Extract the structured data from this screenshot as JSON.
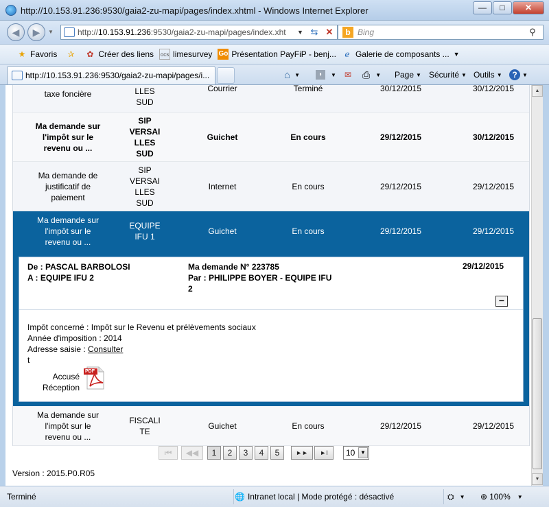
{
  "window": {
    "title": "http://10.153.91.236:9530/gaia2-zu-mapi/pages/index.xhtml - Windows Internet Explorer",
    "minimize": "—",
    "maximize": "□",
    "close": "✕"
  },
  "nav": {
    "url_prefix": "http://",
    "url_host": "10.153.91.236",
    "url_rest": ":9530/gaia2-zu-mapi/pages/index.xht",
    "search_placeholder": "Bing"
  },
  "favorites": {
    "label": "Favoris",
    "items": [
      "Créer des liens",
      "limesurvey",
      "Présentation PayFiP - benj...",
      "Galerie de composants ..."
    ]
  },
  "tab": {
    "label": "http://10.153.91.236:9530/gaia2-zu-mapi/pages/i..."
  },
  "commands": {
    "page": "Page",
    "security": "Sécurité",
    "tools": "Outils"
  },
  "rows": [
    {
      "subject": "taxe foncière",
      "service": [
        "LLES",
        "SUD"
      ],
      "channel": "Courrier",
      "status": "Terminé",
      "date1": "30/12/2015",
      "date2": "30/12/2015"
    },
    {
      "subject": [
        "Ma demande sur",
        "l'impôt sur le",
        "revenu ou ..."
      ],
      "service": [
        "SIP",
        "VERSAI",
        "LLES",
        "SUD"
      ],
      "channel": "Guichet",
      "status": "En cours",
      "date1": "29/12/2015",
      "date2": "30/12/2015"
    },
    {
      "subject": [
        "Ma demande de",
        "justificatif de",
        "paiement"
      ],
      "service": [
        "SIP",
        "VERSAI",
        "LLES",
        "SUD"
      ],
      "channel": "Internet",
      "status": "En cours",
      "date1": "29/12/2015",
      "date2": "29/12/2015"
    },
    {
      "subject": [
        "Ma demande sur",
        "l'impôt sur le",
        "revenu ou ..."
      ],
      "service": [
        "EQUIPE",
        "IFU 1"
      ],
      "channel": "Guichet",
      "status": "En cours",
      "date1": "29/12/2015",
      "date2": "29/12/2015"
    },
    {
      "subject": [
        "Ma demande sur",
        "l'impôt sur le",
        "revenu ou ..."
      ],
      "service": [
        "FISCALI",
        "TE"
      ],
      "channel": "Guichet",
      "status": "En cours",
      "date1": "29/12/2015",
      "date2": "29/12/2015"
    }
  ],
  "detail": {
    "from": "De : PASCAL BARBOLOSI",
    "to": "A : EQUIPE IFU 2",
    "request": "Ma demande N° 223785",
    "by": [
      "Par : PHILIPPE BOYER - EQUIPE IFU",
      "2"
    ],
    "date": "29/12/2015",
    "collapse": "−",
    "tax": "Impôt concerné : Impôt sur le Revenu et prélèvements sociaux",
    "year": "Année d'imposition : 2014",
    "address_label": "Adresse saisie :",
    "address_link": "Consulter",
    "trailing": "t",
    "attachment": [
      "Accusé",
      "Réception"
    ],
    "pdf_label": "PDF"
  },
  "pager": {
    "first": "⏮",
    "prev": "◀◀",
    "pages": [
      "1",
      "2",
      "3",
      "4",
      "5"
    ],
    "next": "►►",
    "last": "►I",
    "page_size": "10"
  },
  "version": "Version : 2015.P0.R05",
  "status": {
    "left": "Terminé",
    "zone": "Intranet local | Mode protégé : désactivé",
    "zoom": "100%"
  }
}
